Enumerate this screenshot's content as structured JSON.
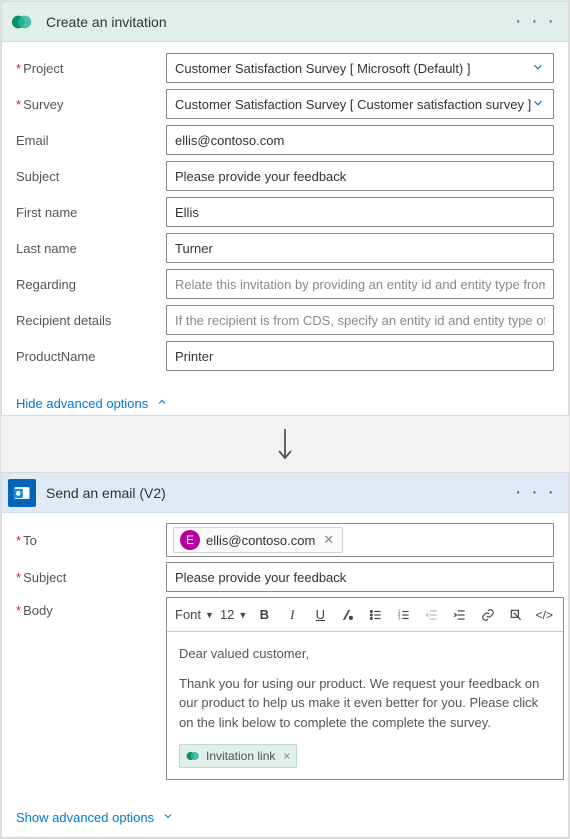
{
  "card1": {
    "title": "Create an invitation",
    "fields": {
      "project": {
        "label": "Project",
        "required": true,
        "value": "Customer Satisfaction Survey [ Microsoft (Default) ]",
        "type": "select"
      },
      "survey": {
        "label": "Survey",
        "required": true,
        "value": "Customer Satisfaction Survey [ Customer satisfaction survey ]",
        "type": "select"
      },
      "email": {
        "label": "Email",
        "required": false,
        "value": "ellis@contoso.com"
      },
      "subject": {
        "label": "Subject",
        "required": false,
        "value": "Please provide your feedback"
      },
      "firstname": {
        "label": "First name",
        "required": false,
        "value": "Ellis"
      },
      "lastname": {
        "label": "Last name",
        "required": false,
        "value": "Turner"
      },
      "regarding": {
        "label": "Regarding",
        "required": false,
        "placeholder": "Relate this invitation by providing an entity id and entity type from this CDS in t"
      },
      "recipient": {
        "label": "Recipient details",
        "required": false,
        "placeholder": "If the recipient is from CDS, specify an entity id and entity type of the recipient t"
      },
      "product": {
        "label": "ProductName",
        "required": false,
        "value": "Printer"
      }
    },
    "toggle": "Hide advanced options"
  },
  "card2": {
    "title": "Send an email (V2)",
    "fields": {
      "to": {
        "label": "To",
        "required": true,
        "chip": {
          "initial": "E",
          "email": "ellis@contoso.com"
        }
      },
      "subject": {
        "label": "Subject",
        "required": true,
        "value": "Please provide your feedback"
      },
      "body": {
        "label": "Body",
        "required": true,
        "toolbar": {
          "font_label": "Font",
          "size_label": "12"
        },
        "content_greeting": "Dear valued customer,",
        "content_para": "Thank you for using our product. We request your feedback on our product to help us make it even better for you. Please click on the link below to complete the complete the survey.",
        "token": "Invitation link"
      }
    },
    "toggle": "Show advanced options"
  }
}
